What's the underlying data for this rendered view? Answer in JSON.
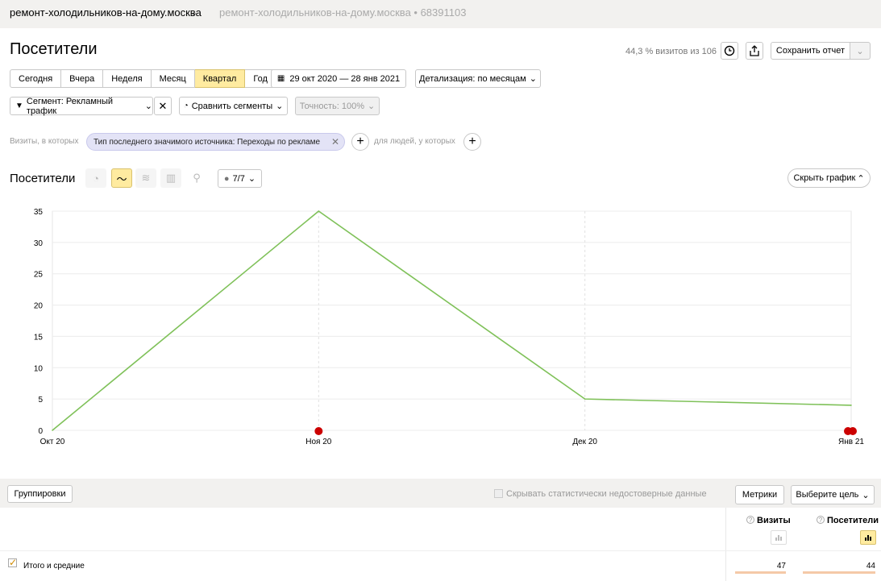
{
  "header": {
    "site_name": "ремонт-холодильников-на-дому.москва",
    "site_url": "ремонт-холодильников-на-дому.москва • 68391103"
  },
  "report": {
    "title": "Посетители",
    "share": "44,3 % визитов из 106",
    "save_label": "Сохранить отчет"
  },
  "periods": [
    "Сегодня",
    "Вчера",
    "Неделя",
    "Месяц",
    "Квартал",
    "Год"
  ],
  "active_period": "Квартал",
  "date_range": "29 окт 2020 — 28 янв 2021",
  "detail": "Детализация: по месяцам",
  "segment": {
    "label": "Сегмент: Рекламный трафик",
    "compare": "Сравнить сегменты",
    "accuracy": "Точность: 100%"
  },
  "filter": {
    "prefix": "Визиты, в которых",
    "chip": "Тип последнего значимого источника: Переходы по рекламе",
    "people": "для людей, у которых"
  },
  "chart_section": {
    "title": "Посетители",
    "metrics_count": "7/7",
    "hide_label": "Скрыть график"
  },
  "chart_data": {
    "type": "line",
    "categories": [
      "Окт 20",
      "Ноя 20",
      "Дек 20",
      "Янв 21"
    ],
    "series": [
      {
        "values": [
          0,
          35,
          5,
          4
        ],
        "color": "#7fc159"
      }
    ],
    "ylim": [
      0,
      35
    ],
    "yticks": [
      0,
      5,
      10,
      15,
      20,
      25,
      30,
      35
    ],
    "grid": true
  },
  "toolbar": {
    "groupings": "Группировки",
    "hide_unreliable": "Скрывать статистически недостоверные данные",
    "metrics": "Метрики",
    "goal": "Выберите цель"
  },
  "table": {
    "columns": [
      "Визиты",
      "Посетители"
    ],
    "totals_label": "Итого и средние",
    "totals": [
      "47",
      "44"
    ]
  },
  "colors": {
    "accent": "#ffeba0",
    "line": "#7fc159",
    "chip": "#e3e3f6",
    "marker": "#cc0000"
  }
}
